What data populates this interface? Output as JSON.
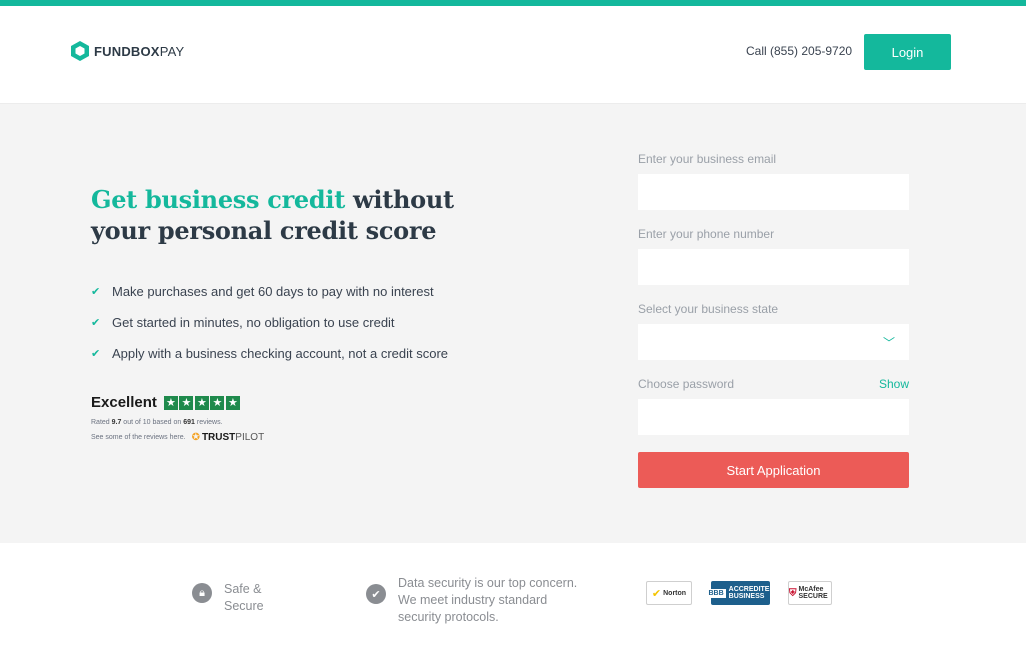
{
  "header": {
    "logo": {
      "bold": "FUNDBOX",
      "light": "PAY"
    },
    "phone": "Call (855) 205-9720",
    "login_label": "Login"
  },
  "hero": {
    "headline_accent": "Get business credit",
    "headline_rest_1": " without",
    "headline_rest_2": "your personal credit score",
    "benefits": [
      "Make purchases and get 60 days to pay with no interest",
      "Get started in minutes, no obligation to use credit",
      "Apply with a business checking account, not a credit score"
    ]
  },
  "trustpilot": {
    "excellent": "Excellent",
    "rated_prefix": "Rated ",
    "rating": "9.7",
    "rated_mid": " out of 10 based on ",
    "review_count": "691",
    "rated_suffix": " reviews.",
    "see_reviews": "See some of the reviews here.",
    "brand_trust": "TRUST",
    "brand_pilot": "PILOT"
  },
  "form": {
    "email_label": "Enter your business email",
    "email_value": "",
    "phone_label": "Enter your phone number",
    "phone_value": "",
    "state_label": "Select your business state",
    "state_value": "",
    "password_label": "Choose password",
    "password_value": "",
    "show_label": "Show",
    "submit_label": "Start Application"
  },
  "footer": {
    "safe_line1": "Safe &",
    "safe_line2": "Secure",
    "security_line1": "Data security is our top concern.",
    "security_line2": "We meet industry standard",
    "security_line3": "security protocols.",
    "badges": {
      "norton": "Norton",
      "bbb_bb": "BBB",
      "bbb_label": "ACCREDITED BUSINESS",
      "mcafee": "McAfee SECURE"
    }
  },
  "colors": {
    "accent": "#14b89c",
    "cta": "#ec5b57",
    "text": "#2d3a46"
  }
}
